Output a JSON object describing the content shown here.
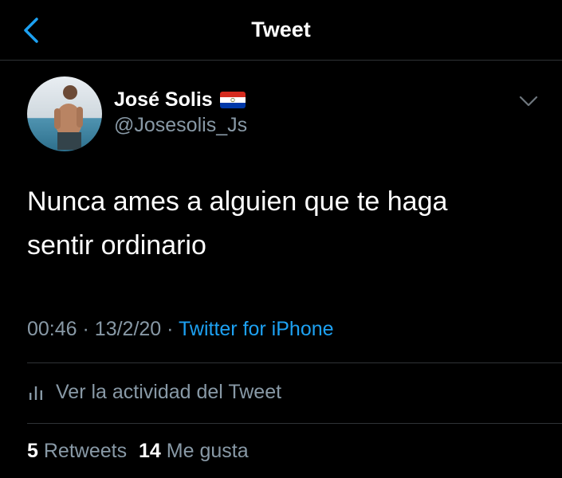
{
  "header": {
    "title": "Tweet",
    "back_icon": "chevron-left-icon"
  },
  "author": {
    "name": "José Solis",
    "flag": "paraguay-flag-icon",
    "handle": "@Josesolis_Js",
    "avatar": "avatar-photo"
  },
  "tweet": {
    "text": "Nunca ames a alguien que te haga\nsentir ordinario"
  },
  "meta": {
    "time": "00:46",
    "separator": "·",
    "date": "13/2/20",
    "source": "Twitter for iPhone"
  },
  "activity": {
    "icon": "bar-chart-icon",
    "label": "Ver la actividad del Tweet"
  },
  "stats": {
    "retweets_count": "5",
    "retweets_label": "Retweets",
    "likes_count": "14",
    "likes_label": "Me gusta"
  },
  "colors": {
    "background": "#000000",
    "accent": "#1da1f2",
    "secondary_text": "#8899a6",
    "divider": "#2f3336"
  }
}
